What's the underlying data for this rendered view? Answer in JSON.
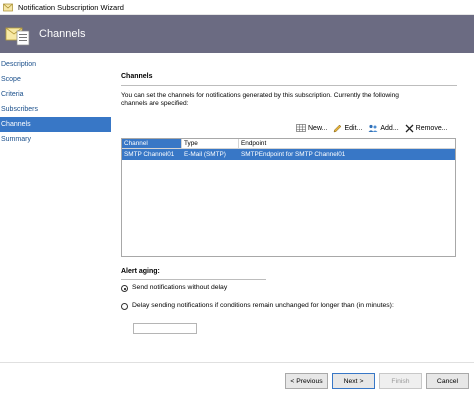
{
  "window": {
    "title": "Notification Subscription Wizard"
  },
  "header": {
    "title": "Channels"
  },
  "nav": {
    "items": [
      {
        "label": "Description"
      },
      {
        "label": "Scope"
      },
      {
        "label": "Criteria"
      },
      {
        "label": "Subscribers"
      },
      {
        "label": "Channels",
        "active": true
      },
      {
        "label": "Summary"
      }
    ]
  },
  "main": {
    "section_title": "Channels",
    "description": "You can set the channels for notifications generated by this subscription.  Currently the following channels are specified:"
  },
  "toolbar": {
    "new_label": "New...",
    "edit_label": "Edit...",
    "add_label": "Add...",
    "remove_label": "Remove..."
  },
  "table": {
    "columns": [
      "Channel",
      "Type",
      "Endpoint"
    ],
    "rows": [
      [
        "SMTP Channel01",
        "E-Mail (SMTP)",
        "SMTPEndpoint for SMTP Channel01"
      ]
    ]
  },
  "aging": {
    "title": "Alert aging:",
    "option_no_delay": "Send notifications without delay",
    "option_delay": "Delay sending notifications if conditions remain unchanged for longer than (in minutes):",
    "minutes_value": ""
  },
  "footer": {
    "previous_label": "< Previous",
    "next_label": "Next >",
    "finish_label": "Finish",
    "cancel_label": "Cancel"
  },
  "colors": {
    "accent": "#3877c6",
    "banner": "#6b6b82"
  }
}
